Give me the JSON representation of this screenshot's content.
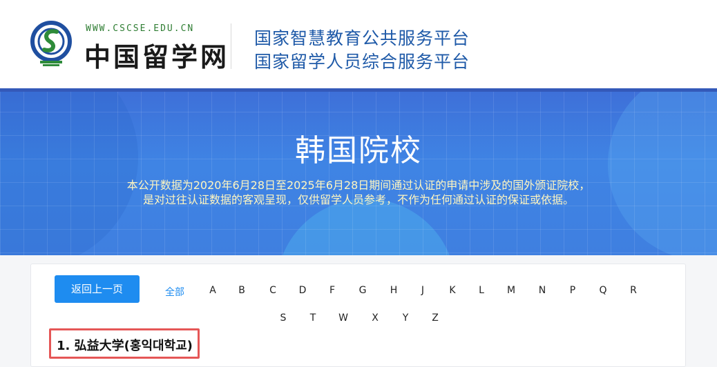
{
  "header": {
    "logo_url_text": "WWW.CSCSE.EDU.CN",
    "logo_cn_text": "中国留学网",
    "platform_line1": "国家智慧教育公共服务平台",
    "platform_line2": "国家留学人员综合服务平台"
  },
  "banner": {
    "title": "韩国院校",
    "desc_line1": "本公开数据为2020年6月28日至2025年6月28日期间通过认证的申请中涉及的国外颁证院校，",
    "desc_line2": "是对过往认证数据的客观呈现，仅供留学人员参考，不作为任何通过认证的保证或依据。"
  },
  "filter": {
    "back_label": "返回上一页",
    "all_label": "全部",
    "row1": [
      "A",
      "B",
      "C",
      "D",
      "F",
      "G",
      "H",
      "J",
      "K",
      "L",
      "M",
      "N",
      "P",
      "Q",
      "R"
    ],
    "row2": [
      "S",
      "T",
      "W",
      "X",
      "Y",
      "Z"
    ]
  },
  "list": {
    "items": [
      {
        "index": "1.",
        "name": "弘益大学(홍익대학교)"
      }
    ]
  },
  "colors": {
    "accent": "#1e8cf0",
    "banner": "#3f84e4",
    "highlight": "#e55656"
  }
}
